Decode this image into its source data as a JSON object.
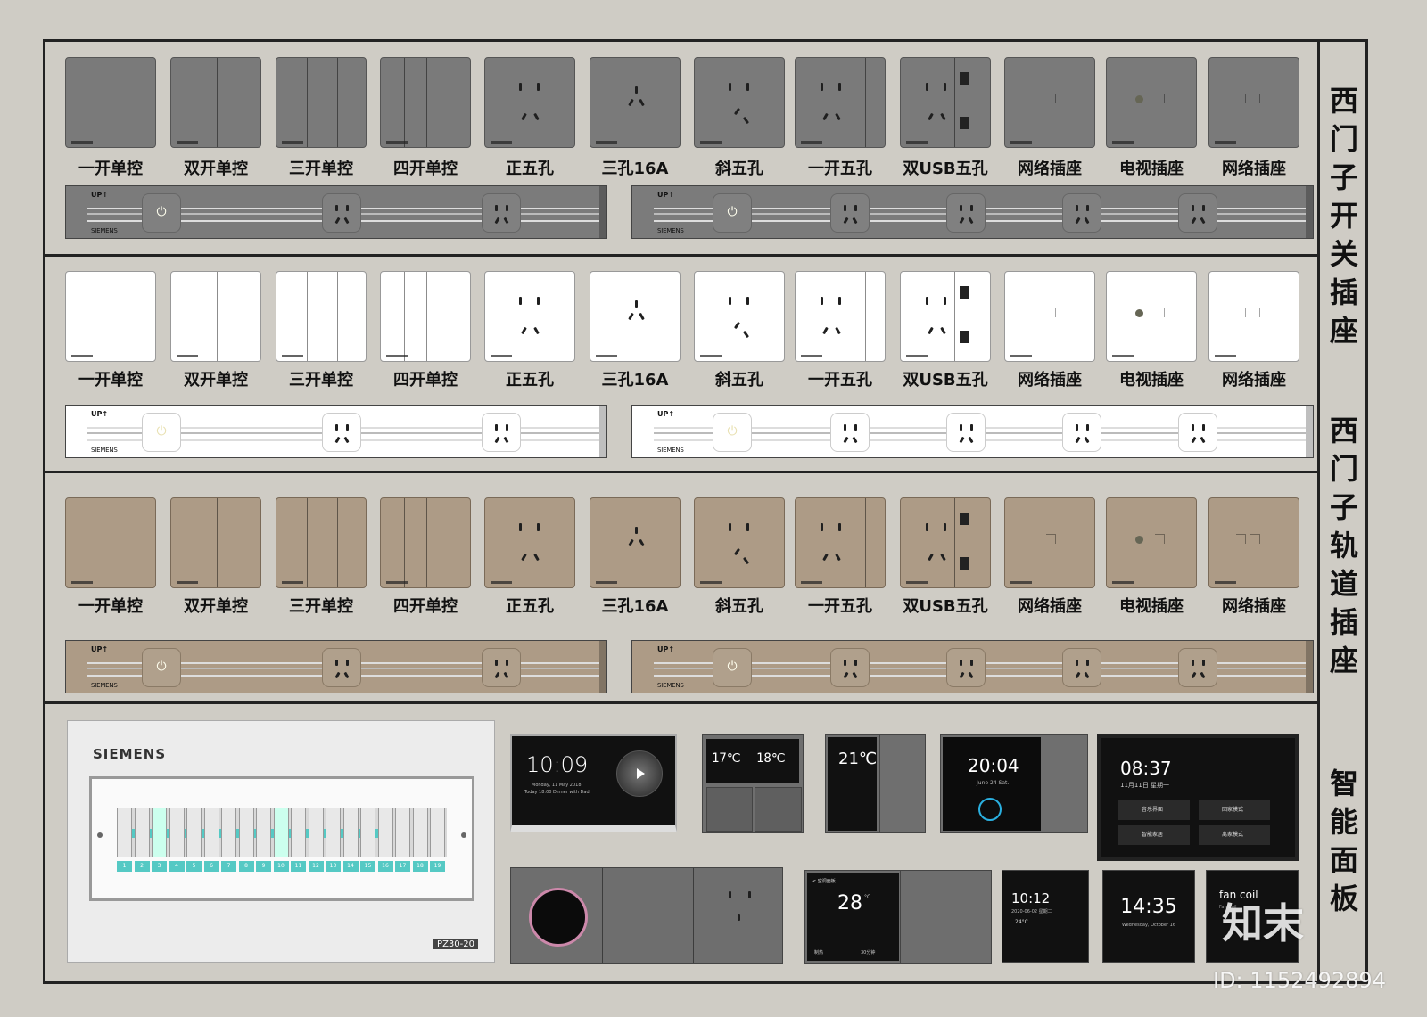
{
  "titles": {
    "switches": "西门子开关插座",
    "rails": "西门子轨道插座",
    "smart": "智能面板"
  },
  "labels": [
    "一开单控",
    "双开单控",
    "三开单控",
    "四开单控",
    "正五孔",
    "三孔16A",
    "斜五孔",
    "一开五孔",
    "双USB五孔",
    "网络插座",
    "电视插座",
    "网络插座"
  ],
  "rail": {
    "up": "UP↑",
    "brand": "SIEMENS",
    "power_icon": "power-icon"
  },
  "colors": {
    "gray": "#7a7a7a",
    "white": "#ffffff",
    "tan": "#ad9b86",
    "frame": "#222222",
    "background": "#cfccc5"
  },
  "distribution_box": {
    "brand": "SIEMENS",
    "model": "PZ30-20",
    "breaker_numbers": [
      "1",
      "2",
      "3",
      "4",
      "5",
      "6",
      "7",
      "8",
      "9",
      "10",
      "11",
      "12",
      "13",
      "14",
      "15",
      "16",
      "17",
      "18",
      "19"
    ]
  },
  "smart_panels": {
    "p1": {
      "time": "10:09",
      "line1": "Monday, 11 May 2018",
      "line2": "Today 18:00 Dinner with Dad"
    },
    "p2": {
      "temp1": "17℃",
      "temp2": "18℃"
    },
    "p3": {
      "value": "21℃"
    },
    "p4": {
      "time": "20:04",
      "date": "June 24 Sat."
    },
    "p5": {
      "time": "08:37",
      "date": "11月11日 星期一",
      "b1": "音乐界面",
      "b2": "回家模式",
      "b3": "智能家居",
      "b4": "离家模式"
    },
    "p6": {
      "time": "",
      "status": ""
    },
    "p7": {
      "value": "28",
      "unit": "°C",
      "header": "< 空调面板",
      "b1": "制热",
      "b2": "30分钟"
    },
    "p8": {
      "time": "10:12",
      "date": "2020-06-02 星期二",
      "temp": "24°C"
    },
    "p9": {
      "time": "14:35",
      "date": "Wednesday, October 16"
    },
    "p10": {
      "title": "fan coil",
      "sub": "Fan Coil"
    }
  },
  "watermark": {
    "logo": "知末",
    "id": "ID: 1152492894"
  }
}
